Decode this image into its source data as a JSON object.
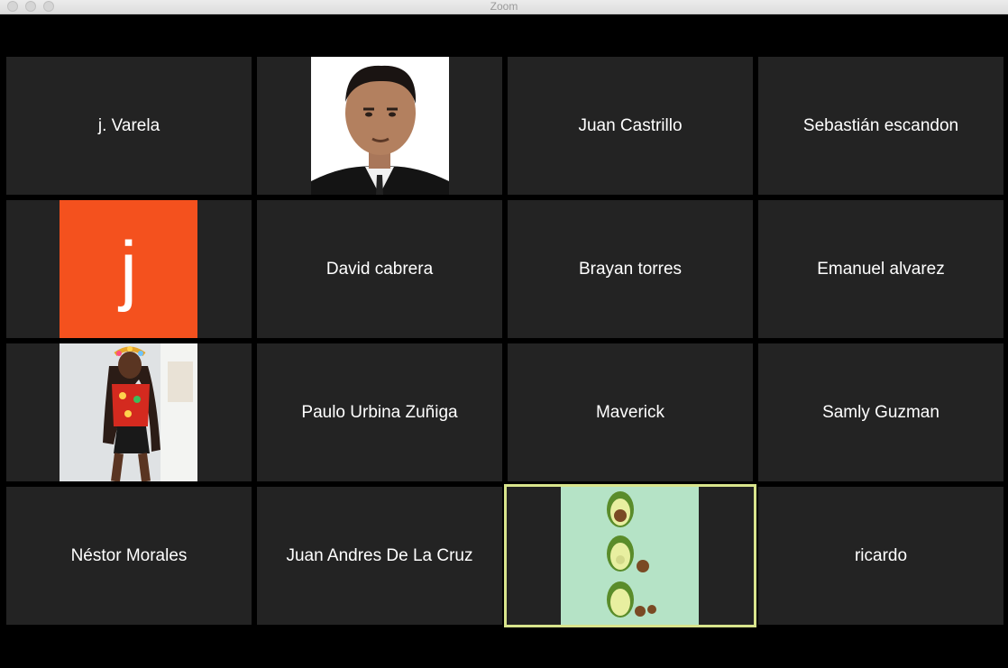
{
  "window": {
    "title": "Zoom"
  },
  "participants": [
    {
      "name": "j. Varela"
    },
    {
      "name": "",
      "media": "photo-man-suit"
    },
    {
      "name": "Juan Castrillo"
    },
    {
      "name": "Sebastián escandon"
    },
    {
      "name": "",
      "media": "avatar",
      "initial": "j",
      "color": "#f4511e"
    },
    {
      "name": "David cabrera"
    },
    {
      "name": "Brayan torres"
    },
    {
      "name": "Emanuel alvarez"
    },
    {
      "name": "",
      "media": "photo-dancer"
    },
    {
      "name": "Paulo Urbina Zuñiga"
    },
    {
      "name": "Maverick"
    },
    {
      "name": "Samly Guzman"
    },
    {
      "name": "Néstor Morales"
    },
    {
      "name": "Juan Andres De La Cruz"
    },
    {
      "name": "",
      "media": "avocado-illustration",
      "active_speaker": true
    },
    {
      "name": "ricardo"
    }
  ],
  "colors": {
    "active_border": "#d8e48c",
    "tile_bg": "#232323"
  }
}
